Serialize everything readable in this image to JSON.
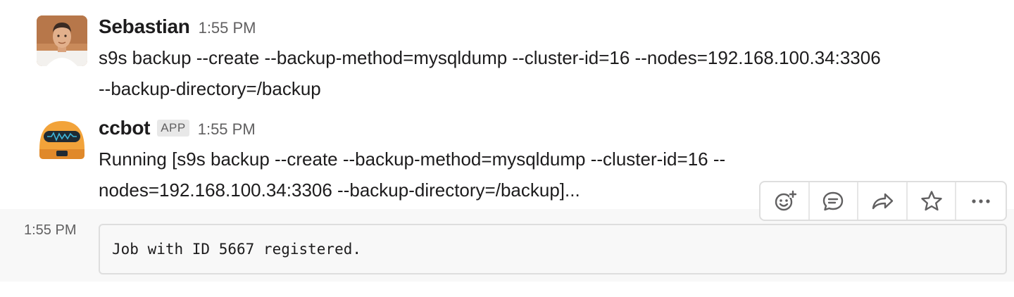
{
  "messages": [
    {
      "sender": "Sebastian",
      "time": "1:55 PM",
      "avatar_icon": "user-photo",
      "lines": [
        "s9s backup --create --backup-method=mysqldump --cluster-id=16 --nodes=192.168.100.34:3306",
        "--backup-directory=/backup"
      ]
    },
    {
      "sender": "ccbot",
      "badge": "APP",
      "time": "1:55 PM",
      "avatar_icon": "robot-icon",
      "lines": [
        "Running [s9s backup --create --backup-method=mysqldump --cluster-id=16 --",
        "nodes=192.168.100.34:3306 --backup-directory=/backup]..."
      ]
    }
  ],
  "followup": {
    "time": "1:55 PM",
    "code": "Job with ID 5667 registered."
  },
  "toolbar": {
    "buttons": [
      "add-reaction-icon",
      "reply-thread-icon",
      "share-icon",
      "star-icon",
      "more-icon"
    ]
  },
  "colors": {
    "text": "#1d1c1d",
    "muted": "#616061",
    "hover_background": "#f8f8f8",
    "border": "#dedede",
    "bot_orange": "#f2a33a"
  }
}
